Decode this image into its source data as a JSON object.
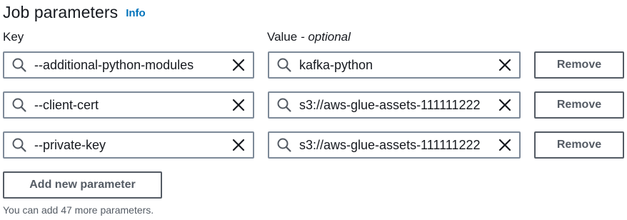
{
  "header": {
    "title": "Job parameters",
    "info_link": "Info"
  },
  "columns": {
    "key_label": "Key",
    "value_label": "Value",
    "value_optional": "- optional"
  },
  "parameters": [
    {
      "key": "--additional-python-modules",
      "value": "kafka-python"
    },
    {
      "key": "--client-cert",
      "value": "s3://aws-glue-assets-111111222"
    },
    {
      "key": "--private-key",
      "value": "s3://aws-glue-assets-111111222"
    }
  ],
  "remove_label": "Remove",
  "add_button_label": "Add new parameter",
  "hint": "You can add 47 more parameters.",
  "icons": {
    "search": "search-icon",
    "clear": "close-icon"
  },
  "colors": {
    "text": "#16191f",
    "link": "#0073bb",
    "field_border": "#7d8998",
    "button_border": "#545b64"
  }
}
